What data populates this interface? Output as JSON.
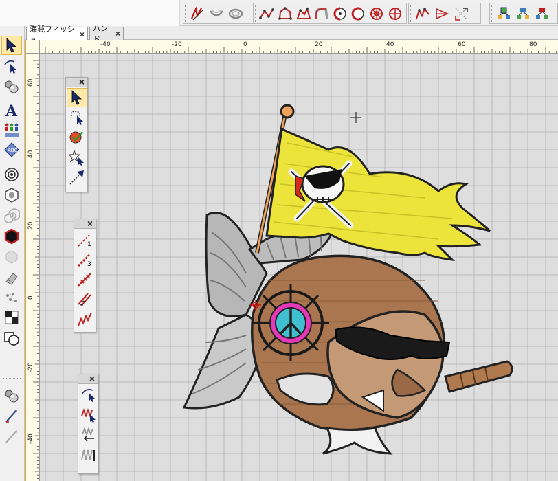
{
  "tabs": [
    {
      "label": "海賊フィッシュ",
      "close_label": "×",
      "active": true
    },
    {
      "label": "ハンド",
      "close_label": "×",
      "active": false
    }
  ],
  "ruler": {
    "horizontal_labels": [
      "-40",
      "-20",
      "0",
      "20",
      "40",
      "60",
      "80"
    ],
    "vertical_labels": [
      "60",
      "40",
      "20",
      "0",
      "-20",
      "-40"
    ]
  },
  "palettes": {
    "select": {
      "close_label": "×",
      "tools": [
        "select-arrow",
        "lasso-select",
        "color-select",
        "magic-select",
        "point-select"
      ]
    },
    "stitch_point": {
      "close_label": "×",
      "tools": [
        "run-stitch-1",
        "run-stitch-3",
        "arrow-run",
        "satin-line",
        "zigzag-run"
      ],
      "labels": [
        "1",
        "3"
      ]
    },
    "edit": {
      "close_label": "×",
      "tools": [
        "reshape",
        "edit-zigzag",
        "back-stitch",
        "stitch-edit"
      ]
    }
  },
  "colors": {
    "accent": "#cc1111",
    "ruler_bg": "#fffbe6",
    "grid_bg": "#dedede",
    "flag_yellow": "#ece43a",
    "fish_brown": "#a97650",
    "fin_gray": "#bdbdbd",
    "peace_pink": "#e639b9",
    "peace_teal": "#3fbfcf"
  }
}
